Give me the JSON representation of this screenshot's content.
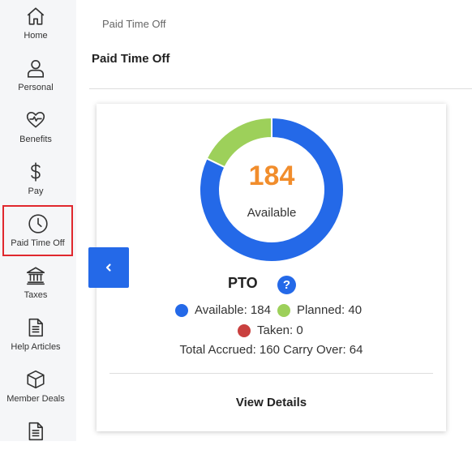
{
  "sidebar": {
    "items": [
      {
        "label": "Home",
        "icon": "home-icon"
      },
      {
        "label": "Personal",
        "icon": "person-icon"
      },
      {
        "label": "Benefits",
        "icon": "heart-pulse-icon"
      },
      {
        "label": "Pay",
        "icon": "dollar-icon"
      },
      {
        "label": "Paid Time Off",
        "icon": "clock-icon",
        "active": true
      },
      {
        "label": "Taxes",
        "icon": "bank-icon"
      },
      {
        "label": "Help Articles",
        "icon": "document-icon"
      },
      {
        "label": "Member Deals",
        "icon": "box-icon"
      },
      {
        "label": "",
        "icon": "document-icon"
      }
    ]
  },
  "header": {
    "breadcrumb": "Paid Time Off",
    "title": "Paid Time Off"
  },
  "pto": {
    "available_value": "184",
    "available_label": "Available",
    "title": "PTO",
    "help_symbol": "?",
    "legend": [
      {
        "label": "Available: 184",
        "color": "#2469e8"
      },
      {
        "label": "Planned: 40",
        "color": "#9dd05a"
      },
      {
        "label": "Taken: 0",
        "color": "#c9403f"
      }
    ],
    "totals": "Total Accrued: 160  Carry Over: 64",
    "view_details": "View Details",
    "donut": {
      "available": 184,
      "planned": 40,
      "taken": 0,
      "colors": {
        "available": "#2469e8",
        "planned": "#9dd05a",
        "taken": "#c9403f"
      }
    }
  },
  "colors": {
    "accent": "#2469e8",
    "highlight": "#f18d2c",
    "active_outline": "#e0282e"
  }
}
